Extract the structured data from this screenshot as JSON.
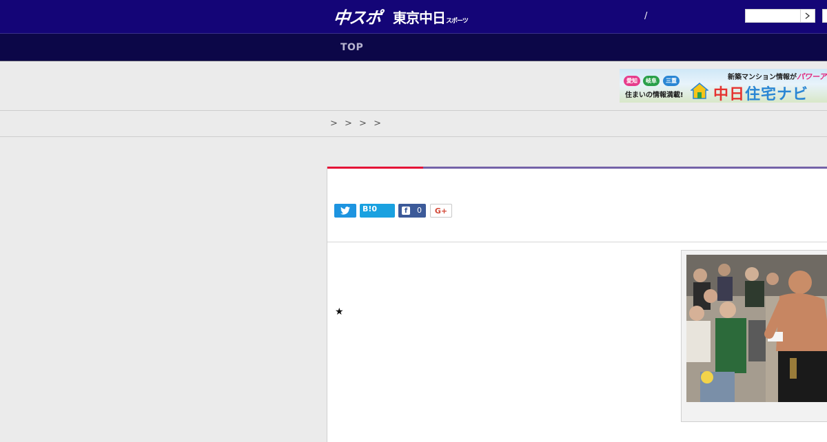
{
  "header": {
    "logo_chuspo": "中スポ",
    "logo_tokyo_main": "東京中日",
    "logo_tokyo_sub": "スポーツ",
    "separator": "/",
    "search_value": "",
    "colors": {
      "header_bg": "#140577",
      "nav_bg": "#0c0748"
    }
  },
  "nav": {
    "items": [
      {
        "label": "TOP"
      }
    ]
  },
  "banner": {
    "top_text_a": "新築マンション情報が",
    "top_text_b": "パワーアップ",
    "chip_1": "愛知",
    "chip_2": "岐阜",
    "chip_3": "三重",
    "line": "住まいの情報満載!",
    "brand_a": "中",
    "brand_b": "日",
    "brand_c": "住宅ナビ"
  },
  "breadcrumb": {
    "text": "> > > >"
  },
  "article": {
    "accent_colors": {
      "red": "#e40f36",
      "purple": "#7462a8"
    },
    "share": {
      "hatena_label": "B!0",
      "facebook_count": "0",
      "google_label": "G+"
    },
    "marker": "★"
  }
}
